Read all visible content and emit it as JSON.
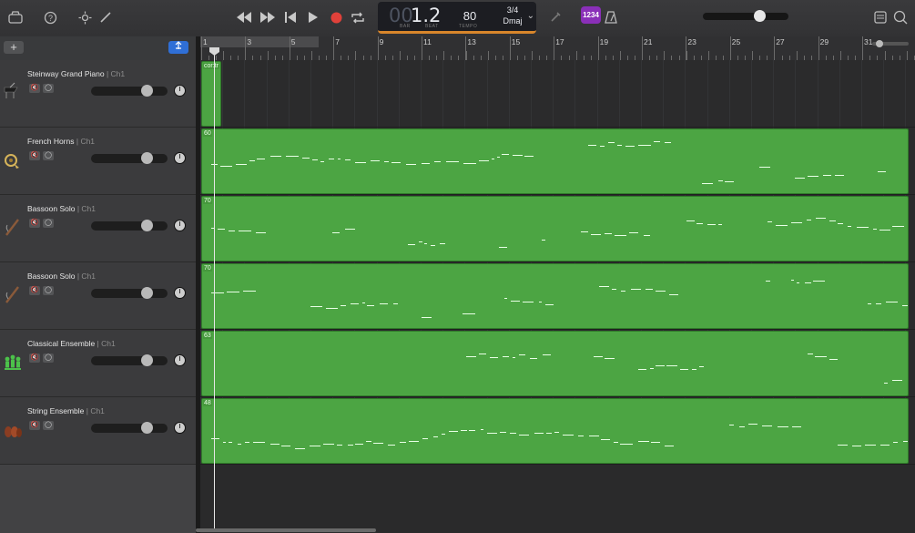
{
  "toolbar": {
    "lcd": {
      "bar_dim": "00",
      "position": "1.2",
      "bar_caption": "BAR",
      "beat_caption": "BEAT",
      "tempo": "80",
      "tempo_caption": "TEMPO",
      "time_signature": "3/4",
      "key": "Dmaj"
    },
    "count_in": "1234",
    "accent_color": "#d8862b"
  },
  "tracks": [
    {
      "name": "Steinway Grand Piano",
      "channel": "| Ch1",
      "instrument_icon": "grand-piano-icon",
      "region_label": "cor:tr"
    },
    {
      "name": "French Horns",
      "channel": "| Ch1",
      "instrument_icon": "horn-icon",
      "region_label": "60"
    },
    {
      "name": "Bassoon Solo",
      "channel": "| Ch1",
      "instrument_icon": "bassoon-icon",
      "region_label": "70"
    },
    {
      "name": "Bassoon Solo",
      "channel": "| Ch1",
      "instrument_icon": "bassoon-icon",
      "region_label": "70"
    },
    {
      "name": "Classical Ensemble",
      "channel": "| Ch1",
      "instrument_icon": "ensemble-icon",
      "region_label": "63"
    },
    {
      "name": "String Ensemble",
      "channel": "| Ch1",
      "instrument_icon": "strings-icon",
      "region_label": "48"
    }
  ],
  "ruler": {
    "bars": [
      "1",
      "3",
      "5",
      "7",
      "9",
      "11",
      "13",
      "15",
      "17",
      "19",
      "21",
      "23",
      "25",
      "27",
      "29",
      "31"
    ]
  },
  "region_color": "#4ca543"
}
